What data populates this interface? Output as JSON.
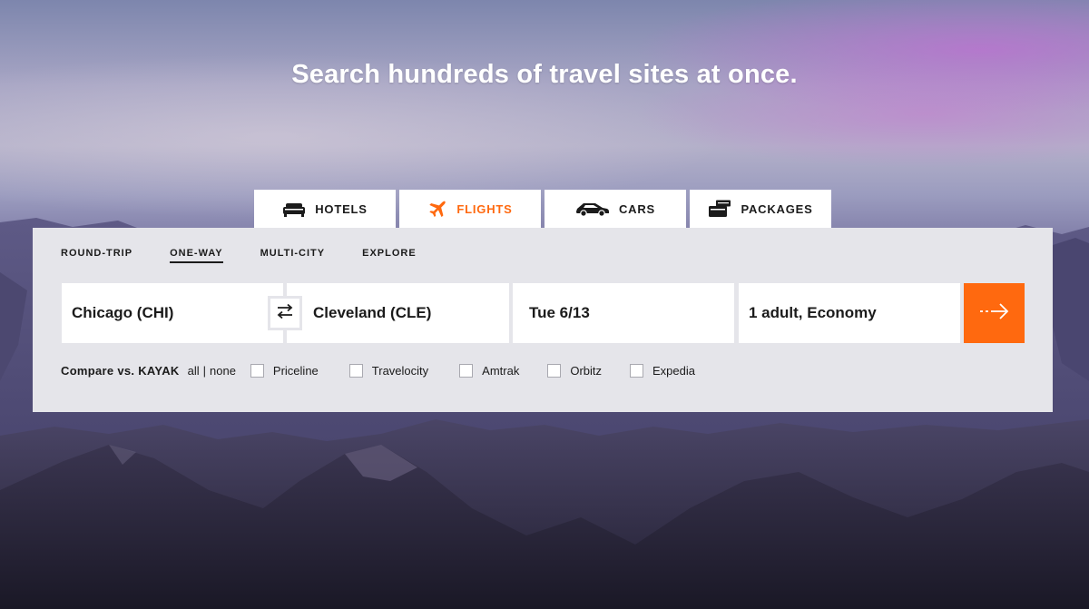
{
  "headline": "Search hundreds of travel sites at once.",
  "vertical_tabs": [
    {
      "label": "HOTELS",
      "icon": "bed-icon",
      "active": false
    },
    {
      "label": "FLIGHTS",
      "icon": "airplane-icon",
      "active": true
    },
    {
      "label": "CARS",
      "icon": "car-icon",
      "active": false
    },
    {
      "label": "PACKAGES",
      "icon": "suitcase-icon",
      "active": false
    }
  ],
  "trip_tabs": [
    {
      "label": "ROUND-TRIP",
      "active": false
    },
    {
      "label": "ONE-WAY",
      "active": true
    },
    {
      "label": "MULTI-CITY",
      "active": false
    },
    {
      "label": "EXPLORE",
      "active": false
    }
  ],
  "search": {
    "origin": "Chicago (CHI)",
    "destination": "Cleveland (CLE)",
    "date": "Tue 6/13",
    "travelers": "1 adult, Economy",
    "swap_icon": "swap-arrows-icon",
    "submit_icon": "arrow-right-icon"
  },
  "compare": {
    "label": "Compare vs. KAYAK",
    "all": "all",
    "separator": "|",
    "none": "none",
    "sites": [
      {
        "name": "Priceline",
        "checked": false
      },
      {
        "name": "Travelocity",
        "checked": false
      },
      {
        "name": "Amtrak",
        "checked": false
      },
      {
        "name": "Orbitz",
        "checked": false
      },
      {
        "name": "Expedia",
        "checked": false
      }
    ]
  },
  "colors": {
    "accent": "#ff690f",
    "panel": "#e5e5ea",
    "text": "#1b1b1b"
  }
}
